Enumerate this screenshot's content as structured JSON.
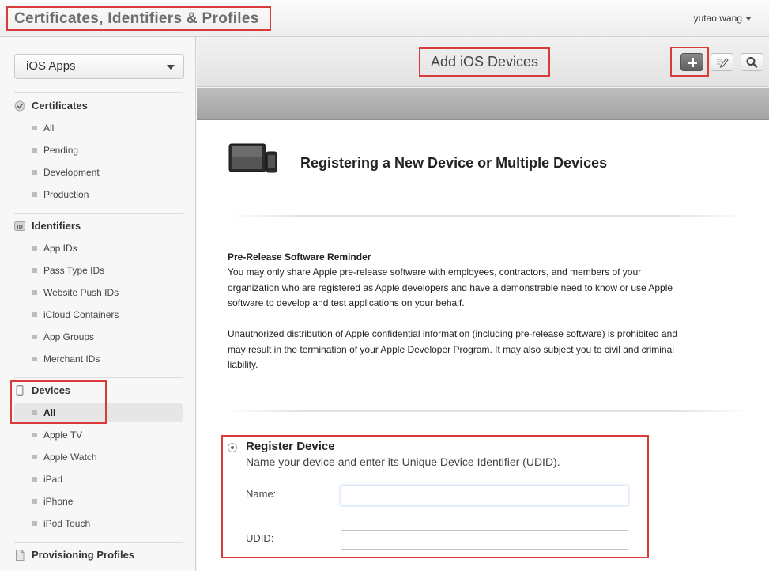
{
  "topbar": {
    "brand": "Certificates, Identifiers & Profiles",
    "user": "yutao wang"
  },
  "sidebar": {
    "platform_select": "iOS Apps",
    "sections": {
      "certificates": {
        "title": "Certificates",
        "items": [
          "All",
          "Pending",
          "Development",
          "Production"
        ]
      },
      "identifiers": {
        "title": "Identifiers",
        "items": [
          "App IDs",
          "Pass Type IDs",
          "Website Push IDs",
          "iCloud Containers",
          "App Groups",
          "Merchant IDs"
        ]
      },
      "devices": {
        "title": "Devices",
        "items": [
          "All",
          "Apple TV",
          "Apple Watch",
          "iPad",
          "iPhone",
          "iPod Touch"
        ],
        "active": "All"
      },
      "profiles": {
        "title": "Provisioning Profiles"
      }
    }
  },
  "header": {
    "title": "Add iOS Devices",
    "tools": [
      "plus-icon",
      "pencil-icon",
      "magnifier-icon"
    ]
  },
  "content": {
    "heading": "Registering a New Device or Multiple Devices",
    "notice_title": "Pre-Release Software Reminder",
    "notice_lines_1": [
      "You may only share Apple pre-release software with employees, contractors, and members of your",
      "organization who are registered as Apple developers and have a demonstrable need to know or use Apple",
      "software to develop and test applications on your behalf."
    ],
    "notice_lines_2": [
      "Unauthorized distribution of Apple confidential information (including pre-release software) is prohibited and",
      "may result in the termination of your Apple Developer Program. It may also subject you to civil and criminal",
      "liability."
    ],
    "register": {
      "label": "Register Device",
      "description": "Name your device and enter its Unique Device Identifier (UDID).",
      "name_label": "Name:",
      "name_value": "",
      "udid_label": "UDID:",
      "udid_value": ""
    }
  },
  "colors": {
    "highlight": "#d93a3a",
    "focus": "#7aa7d8"
  }
}
